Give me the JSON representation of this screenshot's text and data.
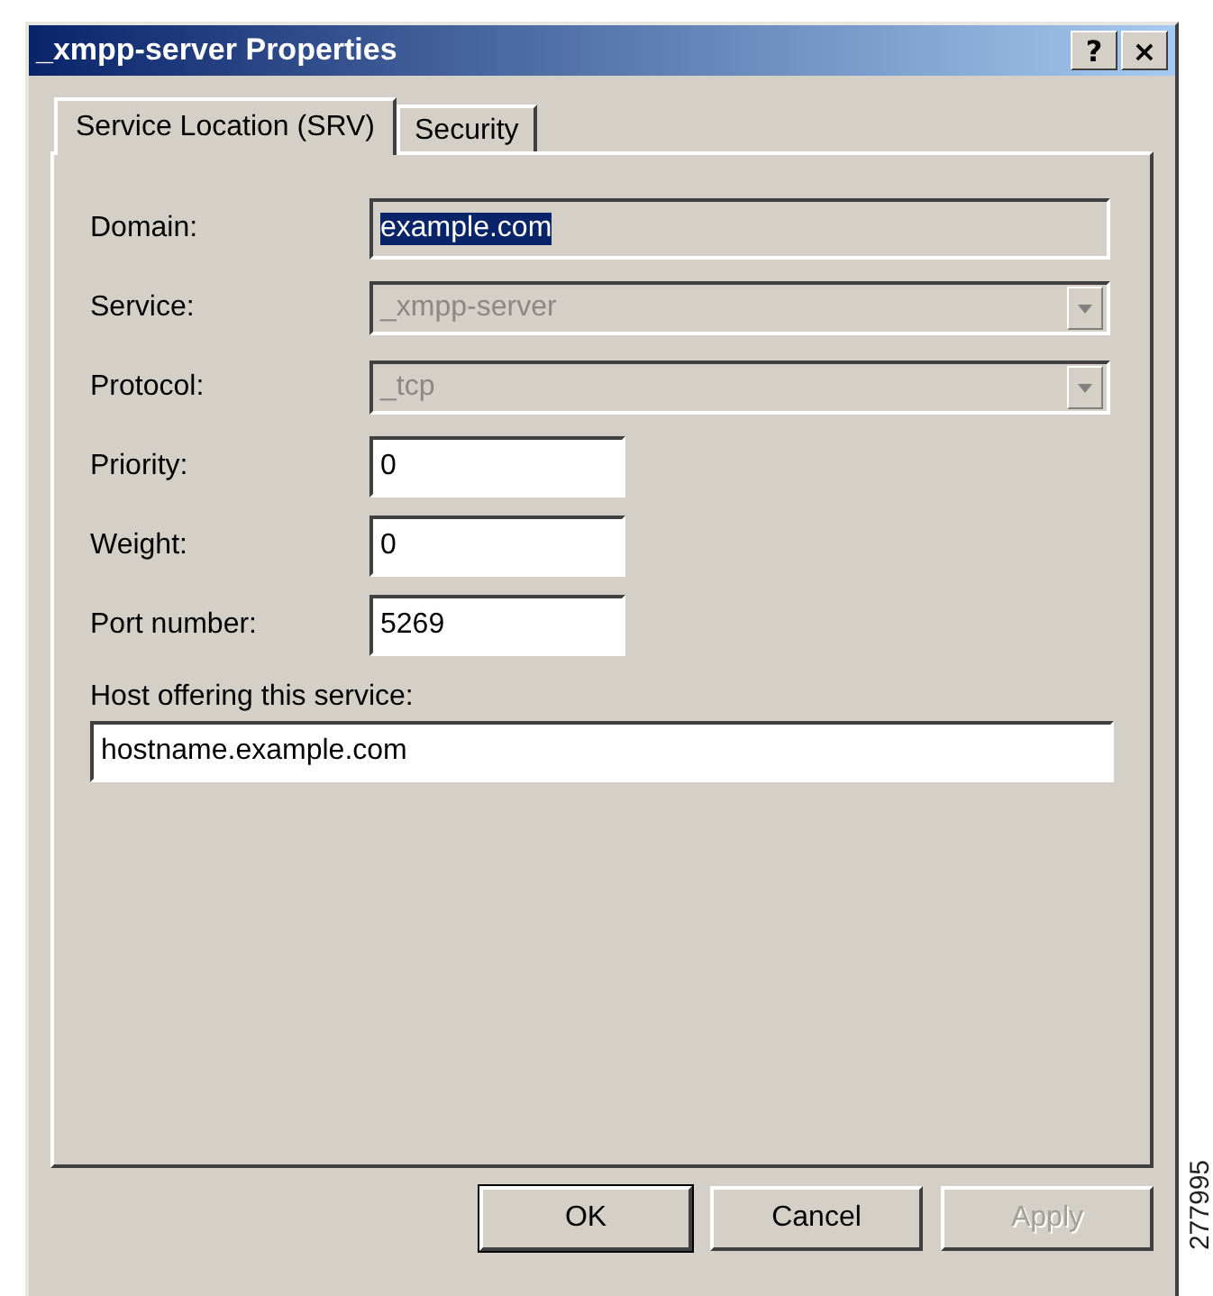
{
  "window": {
    "title": "_xmpp-server Properties",
    "title_buttons": [
      "?",
      "×"
    ]
  },
  "tabs": [
    {
      "label": "Service Location (SRV)",
      "selected": true
    },
    {
      "label": "Security",
      "selected": false
    }
  ],
  "fields": [
    {
      "kind": "wide_text",
      "label": "Domain:",
      "value": "example.com",
      "disabled": true,
      "text_selected": true
    },
    {
      "kind": "combo",
      "label": "Service:",
      "value": "_xmpp-server",
      "disabled": true,
      "text_selected": false
    },
    {
      "kind": "combo",
      "label": "Protocol:",
      "value": "_tcp",
      "disabled": true,
      "text_selected": false
    },
    {
      "kind": "short_text",
      "label": "Priority:",
      "value": "0",
      "disabled": false,
      "text_selected": false
    },
    {
      "kind": "short_text",
      "label": "Weight:",
      "value": "0",
      "disabled": false,
      "text_selected": false
    },
    {
      "kind": "short_text",
      "label": "Port number:",
      "value": "5269",
      "disabled": false,
      "text_selected": false
    },
    {
      "kind": "stacked",
      "label": "Host offering this service:",
      "value": "hostname.example.com",
      "disabled": false,
      "text_selected": false
    }
  ],
  "buttons": [
    {
      "label": "OK",
      "default": true,
      "disabled": false
    },
    {
      "label": "Cancel",
      "default": false,
      "disabled": false
    },
    {
      "label": "Apply",
      "default": false,
      "disabled": true
    }
  ],
  "figure_id": "277995"
}
